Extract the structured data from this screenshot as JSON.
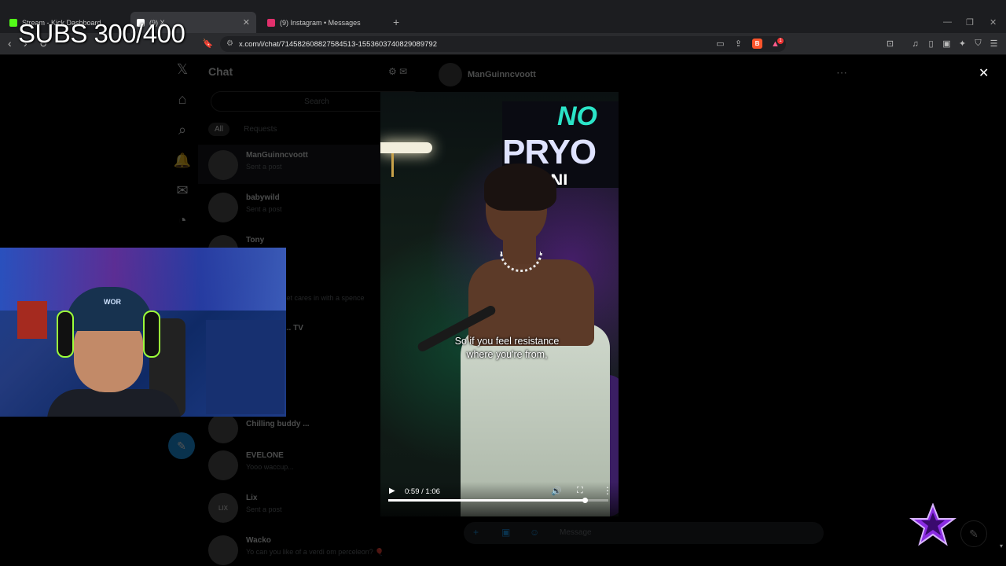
{
  "browser": {
    "tabs": [
      {
        "title": "Stream - Kick Dashboard",
        "favicon_color": "#53fc18"
      },
      {
        "title": "(9) X",
        "favicon_color": "#ffffff"
      },
      {
        "title": "(9) Instagram • Messages",
        "favicon_color": "#e1306c"
      }
    ],
    "url": "x.com/i/chat/714582608827584513-1553603740829089792",
    "new_tab_symbol": "+",
    "rewards_badge": "1"
  },
  "overlay": {
    "subs": "SUBS 300/400"
  },
  "x_page": {
    "chat_title": "Chat",
    "search_placeholder": "Search",
    "filters": [
      "All",
      "Requests"
    ],
    "conversations": [
      {
        "name": "ManGuinncvoott",
        "preview": "Sent a post"
      },
      {
        "name": "babywild",
        "preview": "Sent a post"
      },
      {
        "name": "Tony",
        "preview": ""
      },
      {
        "name": "",
        "preview": "...et cares in with a spence"
      },
      {
        "name": "... TV",
        "preview": ""
      },
      {
        "name": "Chilling buddy ...",
        "preview": ""
      },
      {
        "name": "EVELONE",
        "preview": "Yooo waccup..."
      },
      {
        "name": "Lix",
        "preview": "Sent a post"
      },
      {
        "name": "Wacko",
        "preview": "Yo can you like of a verdi om perceleon? 🎈"
      }
    ],
    "thread_name": "ManGuinncvoott",
    "compose_placeholder": "Message"
  },
  "video": {
    "caption_line1": "So if you feel resistance",
    "caption_line2": "where you're from,",
    "time": "0:59 / 1:06",
    "progress": 0.893,
    "sign_no": "NO",
    "sign_pryo": "PRYO",
    "sign_warn": "WARNI"
  },
  "webcam": {
    "cap_text": "WOR"
  },
  "colors": {
    "accent": "#1d9bf0",
    "subs_text": "#ffffff",
    "sign_teal": "#2be4c8"
  }
}
